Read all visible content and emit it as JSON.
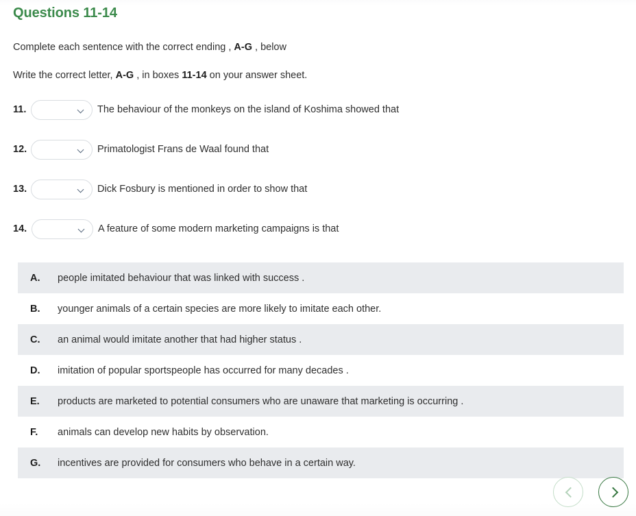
{
  "heading": "Questions 11-14",
  "instructions": {
    "line1_prefix": "Complete each sentence with the correct ending , ",
    "line1_bold": "A-G",
    "line1_suffix": " , below",
    "line2_prefix": "Write the correct letter, ",
    "line2_bold1": "A-G",
    "line2_mid": " , in boxes ",
    "line2_bold2": "11-14",
    "line2_suffix": " on your answer sheet."
  },
  "questions": [
    {
      "number": "11.",
      "dropdown_value": "",
      "dropdown_placeholder": "",
      "text": "The behaviour of the monkeys on the island of Koshima showed that"
    },
    {
      "number": "12.",
      "dropdown_value": "",
      "dropdown_placeholder": "",
      "text": "Primatologist Frans de Waal found that"
    },
    {
      "number": "13.",
      "dropdown_value": "",
      "dropdown_placeholder": "",
      "text": "Dick Fosbury is mentioned in order to show that"
    },
    {
      "number": "14.",
      "dropdown_value": "",
      "dropdown_placeholder": "",
      "text": "A feature of some modern marketing campaigns is that"
    }
  ],
  "options": [
    {
      "letter": "A.",
      "text": "people imitated behaviour that was linked with success ."
    },
    {
      "letter": "B.",
      "text": "younger animals of a certain species are more likely to imitate each other."
    },
    {
      "letter": "C.",
      "text": "an animal would imitate another that had higher status ."
    },
    {
      "letter": "D.",
      "text": "imitation of popular sportspeople has occurred for many decades ."
    },
    {
      "letter": "E.",
      "text": "products are marketed to potential consumers who are unaware that marketing is occurring ."
    },
    {
      "letter": "F.",
      "text": "animals can develop new habits by observation."
    },
    {
      "letter": "G.",
      "text": "incentives are provided for consumers who behave in a certain way."
    }
  ],
  "nav": {
    "prev_label": "Previous",
    "next_label": "Next",
    "prev_icon": "chevron-left-icon",
    "next_icon": "chevron-right-icon"
  },
  "colors": {
    "heading_green": "#3b8a4b",
    "next_green": "#35763f",
    "prev_green": "#c3ddc8",
    "row_shade": "#e9ebee",
    "chevron": "#5a6b80"
  }
}
